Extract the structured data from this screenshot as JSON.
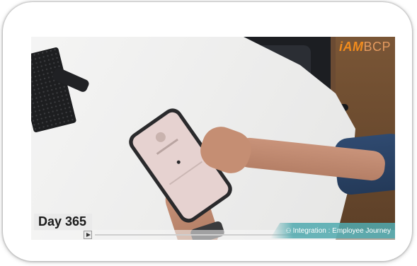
{
  "video": {
    "brand": {
      "i": "i",
      "am": "AM",
      "bcp": "BCP"
    },
    "day_label": "Day 365",
    "ribbon": {
      "icon": "people-icon",
      "text": "Integration : Employee Journey"
    }
  },
  "colors": {
    "brand_orange": "#f28c1d",
    "ribbon_teal": "#50aaaf",
    "sleeve_blue": "#2f4a70"
  }
}
